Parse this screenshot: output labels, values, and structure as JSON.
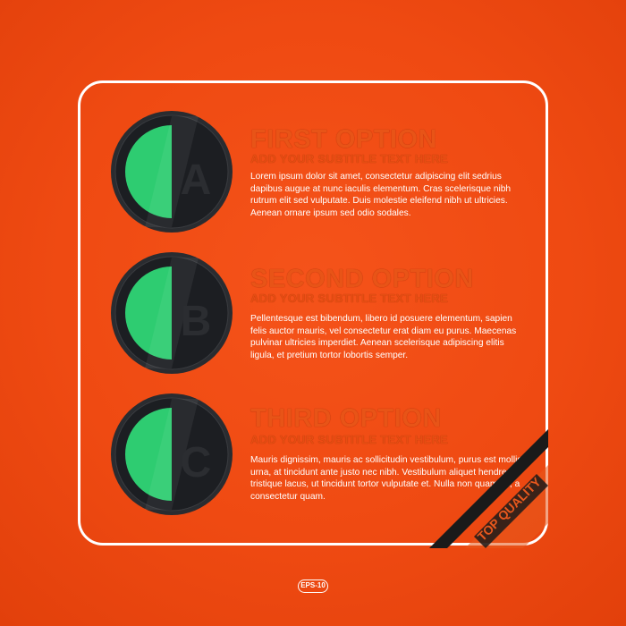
{
  "options": [
    {
      "letter": "A",
      "title": "FIRST OPTION",
      "subtitle": "ADD YOUR SUBTITLE TEXT HERE",
      "body": "Lorem ipsum dolor sit amet, consectetur adipiscing elit sedrius dapibus augue at nunc iaculis elementum. Cras scelerisque nibh rutrum elit sed vulputate. Duis molestie eleifend nibh ut ultricies. Aenean ornare ipsum sed odio sodales."
    },
    {
      "letter": "B",
      "title": "SECOND OPTION",
      "subtitle": "ADD YOUR SUBTITLE TEXT HERE",
      "body": "Pellentesque est bibendum, libero id posuere elementum, sapien felis auctor mauris, vel consectetur erat diam eu purus. Maecenas pulvinar ultricies imperdiet. Aenean scelerisque adipiscing elitis ligula, et pretium tortor lobortis semper."
    },
    {
      "letter": "C",
      "title": "THIRD OPTION",
      "subtitle": "ADD YOUR SUBTITLE TEXT HERE",
      "body": "Mauris dignissim, mauris ac sollicitudin vestibulum, purus est mollis urna, at tincidunt ante justo nec nibh. Vestibulum aliquet hendrerit tristique lacus, ut tincidunt tortor vulputate et. Nulla non quam mi, a consectetur quam."
    }
  ],
  "ribbon": {
    "label": "TOP QUALITY"
  },
  "badge": {
    "label": "EPS-10"
  },
  "colors": {
    "background": "#ef4a12",
    "circle_dark": "#1e2024",
    "circle_green": "#2ecc71",
    "frame": "#ffffff"
  }
}
